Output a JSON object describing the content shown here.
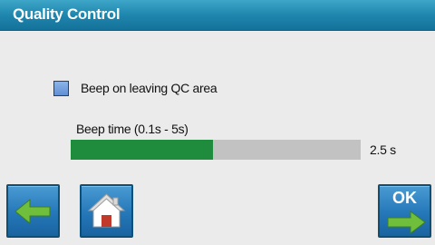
{
  "header": {
    "title": "Quality Control"
  },
  "beep_option": {
    "label": "Beep on leaving QC area",
    "checked": false
  },
  "beep_time": {
    "label": "Beep time (0.1s - 5s)",
    "value_text": "2.5 s",
    "value": 2.5,
    "min": 0.1,
    "max": 5,
    "fill_color": "#1e8c3c"
  },
  "buttons": {
    "back_icon": "arrow-left-icon",
    "home_icon": "home-icon",
    "ok_label": "OK",
    "ok_icon": "arrow-right-icon"
  },
  "colors": {
    "title_bar": "#1f86ad",
    "button": "#2477b8",
    "arrow": "#6fbf3d"
  }
}
